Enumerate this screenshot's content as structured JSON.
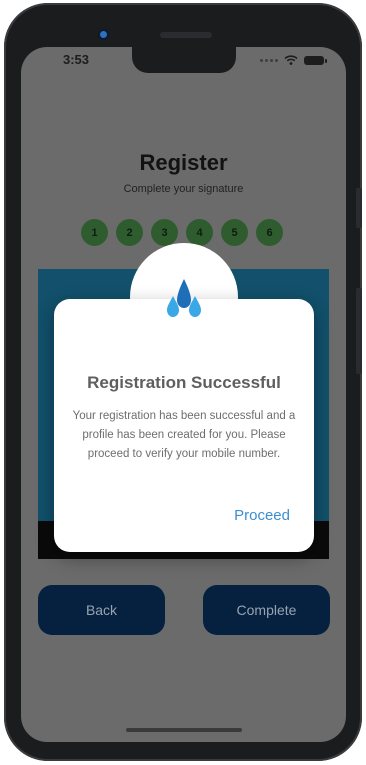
{
  "status_bar": {
    "time": "3:53"
  },
  "page": {
    "title": "Register",
    "subtitle": "Complete your signature",
    "steps": [
      "1",
      "2",
      "3",
      "4",
      "5",
      "6"
    ]
  },
  "buttons": {
    "back_label": "Back",
    "complete_label": "Complete"
  },
  "dialog": {
    "logo_icon": "drops-logo-icon",
    "title": "Registration Successful",
    "message": "Your registration has been successful and a profile has been created for you. Please proceed to verify your mobile number.",
    "action_label": "Proceed"
  },
  "colors": {
    "overlay_dim": "#6b6b6b",
    "button_bg": "#06213f",
    "step_bg": "#2f5c2f",
    "signature_panel": "#12506b",
    "link": "#3b8fd1",
    "logo_blue": "#1f6fb8",
    "logo_light": "#3aa7e6"
  }
}
